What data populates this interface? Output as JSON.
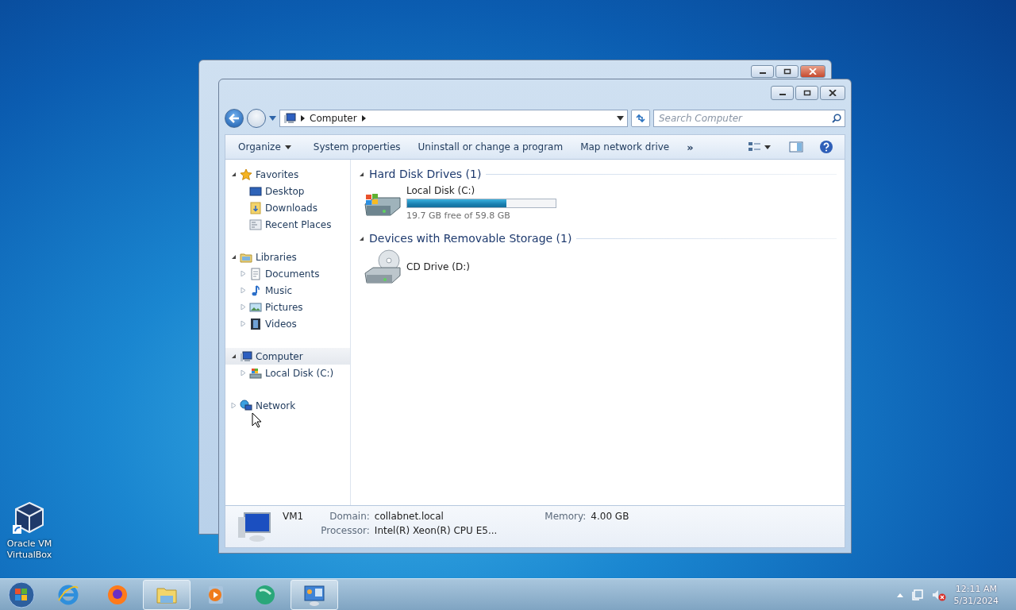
{
  "desktop_icons": [
    {
      "label": "Oracle VM VirtualBox"
    }
  ],
  "explorer": {
    "address": {
      "path": [
        "Computer"
      ]
    },
    "search": {
      "placeholder": "Search Computer"
    },
    "toolbar": [
      {
        "label": "Organize",
        "kind": "menu"
      },
      {
        "label": "System properties",
        "kind": "button"
      },
      {
        "label": "Uninstall or change a program",
        "kind": "button"
      },
      {
        "label": "Map network drive",
        "kind": "button"
      },
      {
        "label": "»",
        "kind": "overflow"
      }
    ],
    "nav": [
      {
        "label": "Favorites",
        "expanded": true,
        "selected": false,
        "children": [
          {
            "label": "Desktop",
            "selected": false
          },
          {
            "label": "Downloads",
            "selected": false
          },
          {
            "label": "Recent Places",
            "selected": false
          }
        ]
      },
      {
        "label": "Libraries",
        "expanded": true,
        "selected": false,
        "children": [
          {
            "label": "Documents",
            "expanded": false,
            "selected": false
          },
          {
            "label": "Music",
            "expanded": false,
            "selected": false
          },
          {
            "label": "Pictures",
            "expanded": false,
            "selected": false
          },
          {
            "label": "Videos",
            "expanded": false,
            "selected": false
          }
        ]
      },
      {
        "label": "Computer",
        "expanded": true,
        "selected": true,
        "children": [
          {
            "label": "Local Disk (C:)",
            "expanded": false,
            "selected": false
          }
        ]
      },
      {
        "label": "Network",
        "expanded": false,
        "selected": false
      }
    ],
    "groups": [
      {
        "title": "Hard Disk Drives (1)",
        "expanded": true,
        "items": [
          {
            "name": "Local Disk (C:)",
            "kind": "disk",
            "level": 0.67,
            "reading": "19.7 GB free of 59.8 GB"
          }
        ]
      },
      {
        "title": "Devices with Removable Storage (1)",
        "expanded": true,
        "items": [
          {
            "name": "CD Drive (D:)",
            "kind": "cd"
          }
        ]
      }
    ],
    "details": {
      "name": "VM1",
      "fields": [
        {
          "label": "Domain:",
          "value": "collabnet.local"
        },
        {
          "label": "Memory:",
          "value": "4.00 GB"
        },
        {
          "label": "Processor:",
          "value": "Intel(R) Xeon(R) CPU E5..."
        }
      ]
    }
  },
  "taskbar": {
    "items": [
      {
        "running": false
      },
      {
        "running": false
      },
      {
        "running": true
      },
      {
        "running": false
      },
      {
        "running": false
      },
      {
        "running": true
      }
    ],
    "clock": {
      "time": "12:11 AM",
      "date": "5/31/2024"
    }
  }
}
